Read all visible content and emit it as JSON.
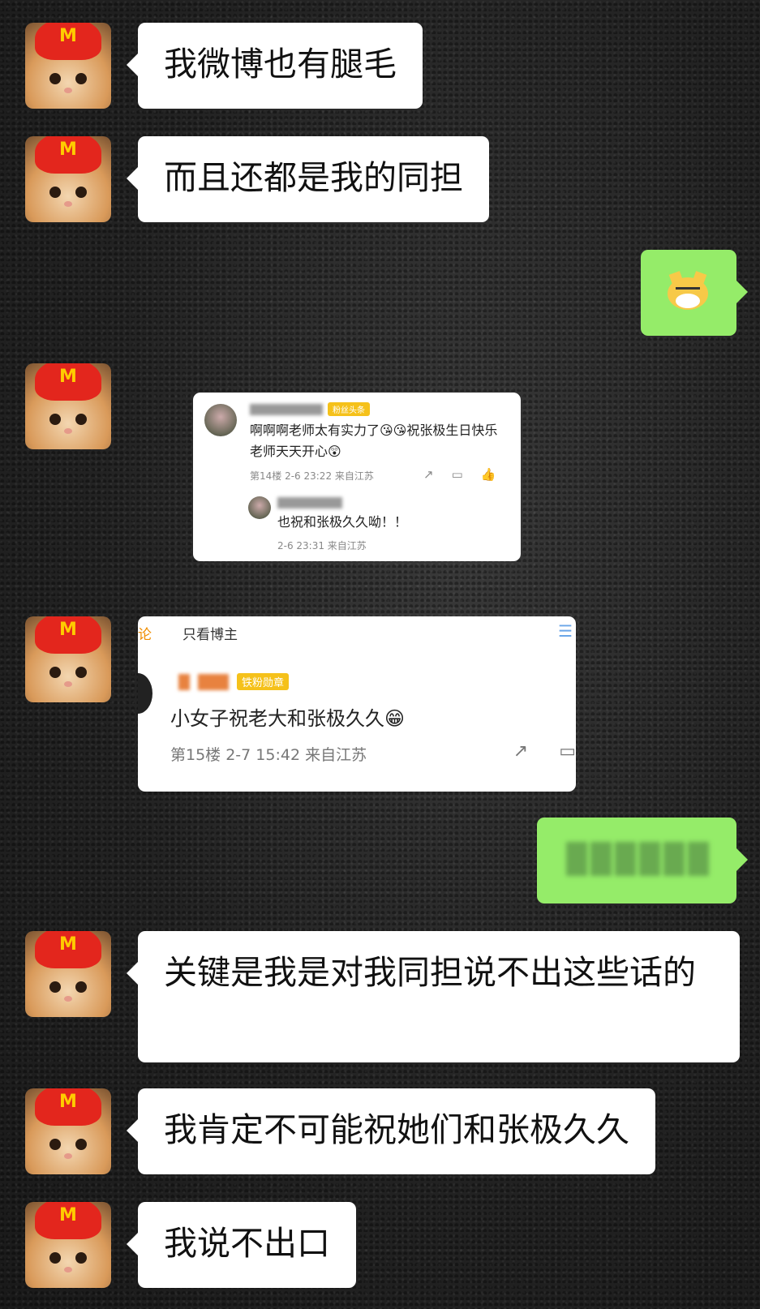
{
  "messages": [
    {
      "side": "left",
      "text": "我微博也有腿毛"
    },
    {
      "side": "left",
      "text": "而且还都是我的同担"
    },
    {
      "side": "right",
      "emoji": "doge-emoji"
    },
    {
      "side": "left",
      "image": "weibo-comment-1"
    },
    {
      "side": "left",
      "image": "weibo-comment-2"
    },
    {
      "side": "right",
      "text": "",
      "censored": true
    },
    {
      "side": "left",
      "text": "关键是我是对我同担说不出这些话的"
    },
    {
      "side": "left",
      "text": "我肯定不可能祝她们和张极久久"
    },
    {
      "side": "left",
      "text": "我说不出口"
    }
  ],
  "avatar": {
    "logo": "M",
    "icon": "cat-avatar-icon"
  },
  "colors": {
    "white_bubble": "#ffffff",
    "green_bubble": "#95ec69",
    "badge": "#f5c11a"
  },
  "weibo1": {
    "badge": "粉丝头条",
    "comment": "啊啊啊老师太有实力了😘😘祝张极生日快乐 老师天天开心😲",
    "meta": "第14楼 2-6 23:22 来自江苏",
    "reply": "也祝和张极久久呦！！",
    "reply_meta": "2-6 23:31 来自江苏"
  },
  "weibo2": {
    "tab": "论",
    "filter": "只看博主",
    "badge": "铁粉勋章",
    "comment": "小女子祝老大和张极久久😁",
    "meta": "第15楼 2-7 15:42 来自江苏"
  }
}
